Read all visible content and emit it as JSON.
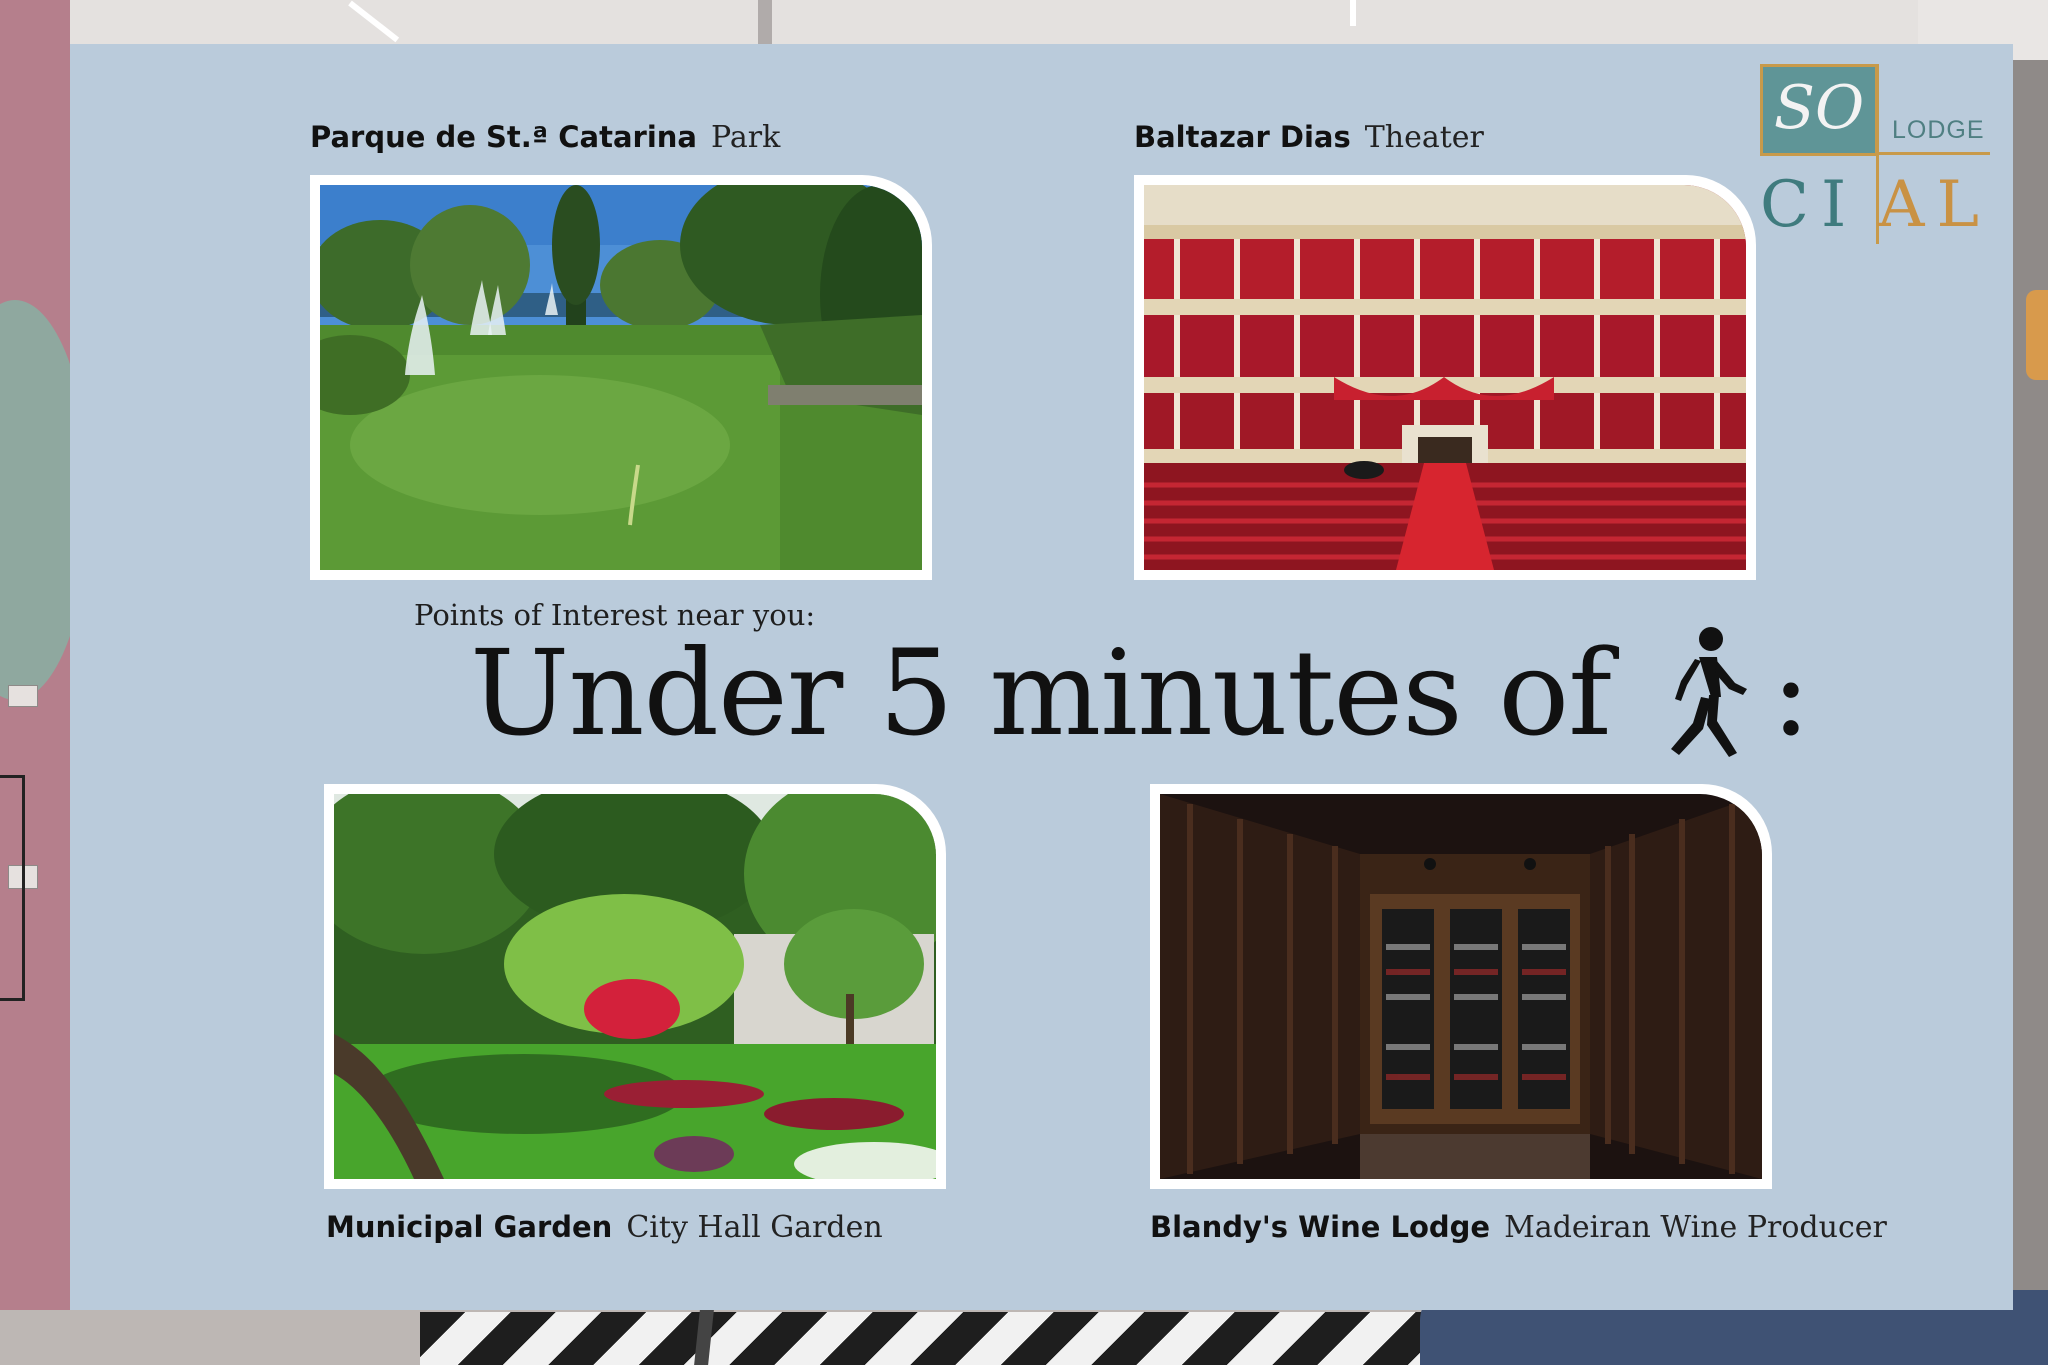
{
  "board": {
    "subheading": "Points of Interest near you:",
    "heading": "Under 5 minutes of",
    "heading_suffix": ":",
    "walk_icon": "walking-person-icon"
  },
  "logo": {
    "so": "SO",
    "lodge": "LODGE",
    "cial_ci": "CI",
    "cial_al": "AL"
  },
  "places": [
    {
      "name": "Parque de St.ª Catarina",
      "kind": "Park"
    },
    {
      "name": "Baltazar Dias",
      "kind": "Theater"
    },
    {
      "name": "Municipal Garden",
      "kind": "City Hall Garden"
    },
    {
      "name": "Blandy's Wine Lodge",
      "kind": "Madeiran Wine Producer"
    }
  ],
  "colors": {
    "board": "#bacbdb",
    "logo_teal": "#5f9597",
    "logo_gold": "#c89a4a"
  }
}
